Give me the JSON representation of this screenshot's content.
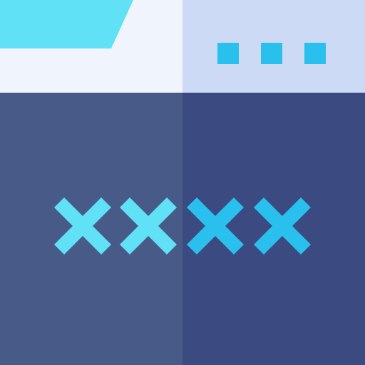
{
  "window": {
    "tab_color": "#61e1f5",
    "titlebar_left_color": "#f0f4fd",
    "titlebar_right_color": "#cddaf6",
    "menu_icon": "more-dots-icon",
    "menu_dot_color": "#29c0ee"
  },
  "content": {
    "left_color": "#485a88",
    "right_color": "#3b4a81"
  },
  "password": {
    "mask_icon": "x-mark-icon",
    "masked_count": 4,
    "left_mark_color": "#61e1f5",
    "right_mark_color": "#29c0ee"
  }
}
